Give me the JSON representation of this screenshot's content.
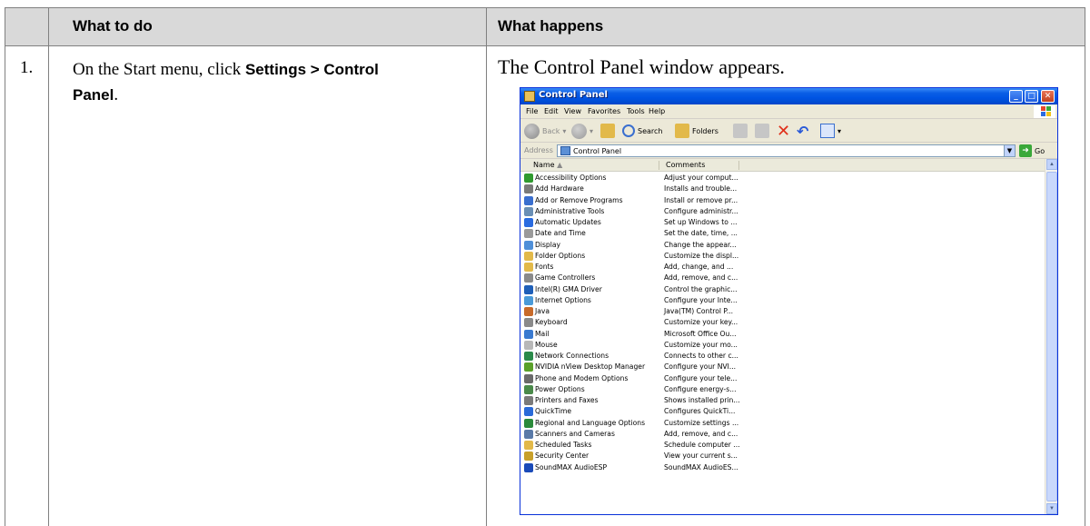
{
  "table": {
    "header_col1": "What to do",
    "header_col2": "What happens",
    "step_number": "1.",
    "step_text_prefix": "On the Start menu, click ",
    "step_text_bold": "Settings > Control Panel",
    "step_text_suffix": ".",
    "result_text": "The Control Panel window appears."
  },
  "window": {
    "title": "Control Panel",
    "menu": [
      "File",
      "Edit",
      "View",
      "Favorites",
      "Tools",
      "Help"
    ],
    "toolbar": {
      "back": "Back",
      "search": "Search",
      "folders": "Folders"
    },
    "address_label": "Address",
    "address_value": "Control Panel",
    "go_label": "Go",
    "columns": {
      "name": "Name",
      "comments": "Comments"
    },
    "items": [
      {
        "name": "Accessibility Options",
        "comment": "Adjust your comput...",
        "color": "#2f9a2f"
      },
      {
        "name": "Add Hardware",
        "comment": "Installs and trouble...",
        "color": "#7a7a7a"
      },
      {
        "name": "Add or Remove Programs",
        "comment": "Install or remove pr...",
        "color": "#3a6fcf"
      },
      {
        "name": "Administrative Tools",
        "comment": "Configure administr...",
        "color": "#6a8fb5"
      },
      {
        "name": "Automatic Updates",
        "comment": "Set up Windows to ...",
        "color": "#2a6be0"
      },
      {
        "name": "Date and Time",
        "comment": "Set the date, time, ...",
        "color": "#9a9a9a"
      },
      {
        "name": "Display",
        "comment": "Change the appear...",
        "color": "#4f8fd8"
      },
      {
        "name": "Folder Options",
        "comment": "Customize the displ...",
        "color": "#e2b94a"
      },
      {
        "name": "Fonts",
        "comment": "Add, change, and ...",
        "color": "#e2b94a"
      },
      {
        "name": "Game Controllers",
        "comment": "Add, remove, and c...",
        "color": "#8a8a8a"
      },
      {
        "name": "Intel(R) GMA Driver",
        "comment": "Control the graphic...",
        "color": "#1f5fb8"
      },
      {
        "name": "Internet Options",
        "comment": "Configure your Inte...",
        "color": "#4a9ad8"
      },
      {
        "name": "Java",
        "comment": "Java(TM) Control P...",
        "color": "#c86a2a"
      },
      {
        "name": "Keyboard",
        "comment": "Customize your key...",
        "color": "#8a8a8a"
      },
      {
        "name": "Mail",
        "comment": "Microsoft Office Ou...",
        "color": "#3a7ad0"
      },
      {
        "name": "Mouse",
        "comment": "Customize your mo...",
        "color": "#b8b8b8"
      },
      {
        "name": "Network Connections",
        "comment": "Connects to other c...",
        "color": "#2a8a4a"
      },
      {
        "name": "NVIDIA nView Desktop Manager",
        "comment": "Configure your NVI...",
        "color": "#5aa02a"
      },
      {
        "name": "Phone and Modem Options",
        "comment": "Configure your tele...",
        "color": "#6a6a6a"
      },
      {
        "name": "Power Options",
        "comment": "Configure energy-s...",
        "color": "#4a8a4a"
      },
      {
        "name": "Printers and Faxes",
        "comment": "Shows installed prin...",
        "color": "#7a7a7a"
      },
      {
        "name": "QuickTime",
        "comment": "Configures QuickTi...",
        "color": "#2a6ad8"
      },
      {
        "name": "Regional and Language Options",
        "comment": "Customize settings ...",
        "color": "#2a8a3a"
      },
      {
        "name": "Scanners and Cameras",
        "comment": "Add, remove, and c...",
        "color": "#5a7aa8"
      },
      {
        "name": "Scheduled Tasks",
        "comment": "Schedule computer ...",
        "color": "#e2b94a"
      },
      {
        "name": "Security Center",
        "comment": "View your current s...",
        "color": "#c8a02a"
      },
      {
        "name": "SoundMAX AudioESP",
        "comment": "SoundMAX AudioES...",
        "color": "#1a4ab8"
      }
    ]
  }
}
